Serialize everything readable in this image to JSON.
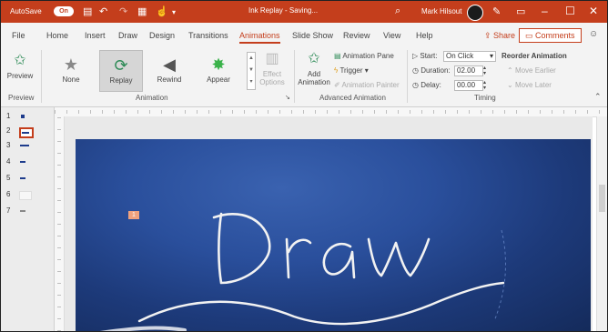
{
  "titlebar": {
    "autosave_label": "AutoSave",
    "autosave_state": "On",
    "doc_title": "Ink Replay - Saving...",
    "user_name": "Mark Hilsout",
    "bg_color": "#c43e1c"
  },
  "tabs": [
    {
      "label": "File"
    },
    {
      "label": "Home"
    },
    {
      "label": "Insert"
    },
    {
      "label": "Draw"
    },
    {
      "label": "Design"
    },
    {
      "label": "Transitions"
    },
    {
      "label": "Animations",
      "active": true
    },
    {
      "label": "Slide Show"
    },
    {
      "label": "Review"
    },
    {
      "label": "View"
    },
    {
      "label": "Help"
    }
  ],
  "share_label": "Share",
  "comments_label": "Comments",
  "ribbon": {
    "preview": {
      "label": "Preview",
      "group": "Preview"
    },
    "effects": [
      {
        "label": "None",
        "icon": "star-outline-icon"
      },
      {
        "label": "Replay",
        "icon": "replay-icon",
        "selected": true
      },
      {
        "label": "Rewind",
        "icon": "rewind-icon"
      },
      {
        "label": "Appear",
        "icon": "star-green-icon"
      }
    ],
    "effect_options_label": "Effect Options",
    "animation_group": "Animation",
    "add_animation_label": "Add Animation",
    "animation_pane_label": "Animation Pane",
    "trigger_label": "Trigger",
    "animation_painter_label": "Animation Painter",
    "advanced_group": "Advanced Animation",
    "start_label": "Start:",
    "start_value": "On Click",
    "duration_label": "Duration:",
    "duration_value": "02.00",
    "delay_label": "Delay:",
    "delay_value": "00.00",
    "reorder_label": "Reorder Animation",
    "move_earlier_label": "Move Earlier",
    "move_later_label": "Move Later",
    "timing_group": "Timing"
  },
  "thumbnails": [
    {
      "num": "1"
    },
    {
      "num": "2",
      "active": true
    },
    {
      "num": "3"
    },
    {
      "num": "4"
    },
    {
      "num": "5"
    },
    {
      "num": "6"
    },
    {
      "num": "7"
    }
  ],
  "slide": {
    "anim_tag": "1",
    "handwriting": "Draw"
  }
}
